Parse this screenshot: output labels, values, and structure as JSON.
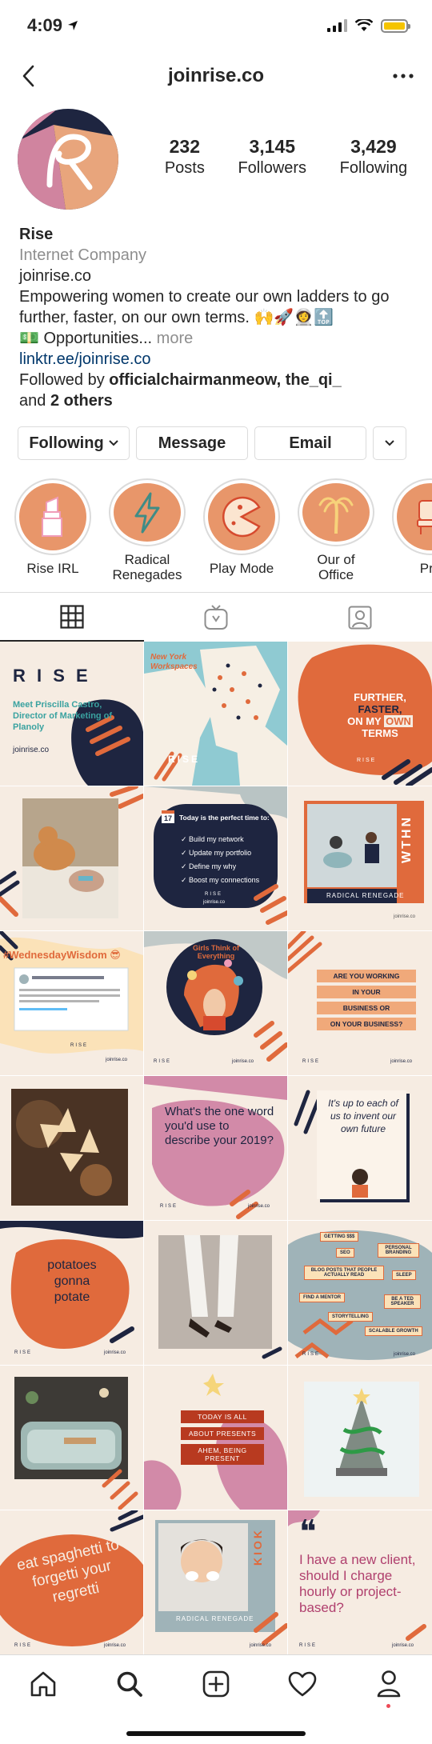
{
  "status_bar": {
    "time": "4:09"
  },
  "header": {
    "username": "joinrise.co"
  },
  "stats": [
    {
      "value": "232",
      "label": "Posts"
    },
    {
      "value": "3,145",
      "label": "Followers"
    },
    {
      "value": "3,429",
      "label": "Following"
    }
  ],
  "bio": {
    "name": "Rise",
    "category": "Internet Company",
    "website_text": "joinrise.co",
    "description_line1": "Empowering women to create our own ladders to go",
    "description_line2": "further, faster, on our own terms. 🙌🚀👩‍🚀🔝",
    "description_line3": "💵 Opportunities...",
    "more": "more",
    "link": "linktr.ee/joinrise.co",
    "followed_by_prefix": "Followed by",
    "followed_by_names": "officialchairmanmeow, the_qi_",
    "followed_by_and": "and",
    "followed_by_others": "2 others"
  },
  "actions": {
    "following": "Following",
    "message": "Message",
    "email": "Email"
  },
  "highlights": [
    {
      "label": "Rise IRL",
      "icon": "lipstick-icon"
    },
    {
      "label": "Radical Renegades",
      "icon": "lightning-icon"
    },
    {
      "label": "Play Mode",
      "icon": "pacman-icon"
    },
    {
      "label": "Our of Office",
      "icon": "palm-tree-icon"
    },
    {
      "label": "Pre",
      "icon": "chair-icon"
    }
  ],
  "tabs": [
    "grid-icon",
    "igtv-icon",
    "tagged-icon"
  ],
  "posts": {
    "p1": {
      "brand": "R I S E",
      "headline": "Meet Priscilla Castro, Director of Marketing of Planoly",
      "footer": "joinrise.co"
    },
    "p2": {
      "title": "New York Workspaces",
      "brand": "RISE"
    },
    "p3": {
      "line1": "FURTHER,",
      "line2": "FASTER,",
      "line3a": "ON MY ",
      "line3b": "OWN",
      "line4": "TERMS",
      "brand": "RISE"
    },
    "p5": {
      "date_num": "17",
      "heading": "Today is the perfect time to:",
      "items": [
        "Build my network",
        "Update my portfolio",
        "Define my why",
        "Boost my connections"
      ],
      "brand": "RISE",
      "footer": "joinrise.co"
    },
    "p6": {
      "side": "WTHN",
      "label": "RADICAL RENEGADE",
      "footer": "joinrise.co"
    },
    "p7": {
      "hashtag": "#WednesdayWisdom 😎",
      "brand": "RISE",
      "footer": "joinrise.co"
    },
    "p8": {
      "title": "Girls Think of Everything",
      "brand": "RISE",
      "footer": "joinrise.co"
    },
    "p9": {
      "lines": [
        "ARE YOU WORKING",
        "IN YOUR",
        "BUSINESS OR",
        "ON YOUR BUSINESS?"
      ],
      "brand": "RISE",
      "footer": "joinrise.co"
    },
    "p11": {
      "question": "What's the one word you'd use to describe your 2019?",
      "brand": "RISE",
      "footer": "joinrise.co"
    },
    "p12": {
      "quote": "It's up to each of us to invent our own future"
    },
    "p13": {
      "line1": "potatoes",
      "line2": "gonna",
      "line3": "potate",
      "brand": "RISE",
      "footer": "joinrise.co"
    },
    "p15": {
      "bubbles": [
        "GETTING $$$",
        "SEO",
        "PERSONAL BRANDING",
        "BLOG POSTS THAT PEOPLE ACTUALLY READ",
        "SLEEP",
        "FIND A MENTOR",
        "BE A TED SPEAKER",
        "STORYTELLING",
        "SCALABLE GROWTH"
      ],
      "brand": "RISE",
      "footer": "joinrise.co"
    },
    "p17": {
      "lines": [
        "TODAY IS ALL",
        "ABOUT PRESENTS",
        "AHEM, BEING PRESENT"
      ]
    },
    "p19": {
      "text": "eat spaghetti to forgetti your regretti",
      "brand": "RISE",
      "footer": "joinrise.co"
    },
    "p20": {
      "side": "KIOK",
      "label": "RADICAL RENEGADE",
      "footer": "joinrise.co"
    },
    "p21": {
      "text": "I have a new client, should I charge hourly or project-based?",
      "brand": "RISE",
      "footer": "joinrise.co"
    }
  },
  "bottom_nav": [
    "home-icon",
    "search-icon",
    "new-post-icon",
    "activity-icon",
    "profile-icon"
  ],
  "colors": {
    "accent_orange": "#e06a3c",
    "navy": "#1e2540",
    "pink": "#d28aa8",
    "cream": "#f6ece2",
    "peach": "#f0a97a",
    "slate": "#9fb3b8"
  }
}
